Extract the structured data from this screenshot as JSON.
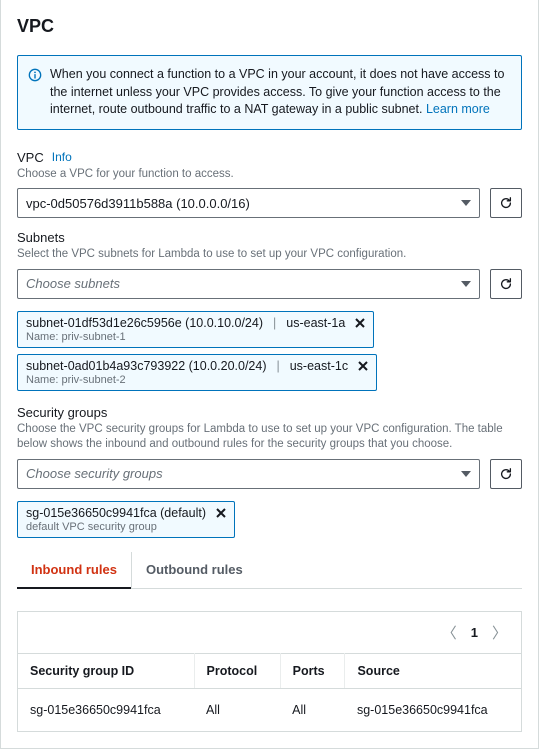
{
  "page": {
    "title": "VPC"
  },
  "info_box": {
    "text": "When you connect a function to a VPC in your account, it does not have access to the internet unless your VPC provides access. To give your function access to the internet, route outbound traffic to a NAT gateway in a public subnet.",
    "learn_more": "Learn more"
  },
  "vpc": {
    "label": "VPC",
    "info_link": "Info",
    "helper": "Choose a VPC for your function to access.",
    "value": "vpc-0d50576d3911b588a (10.0.0.0/16)"
  },
  "subnets": {
    "label": "Subnets",
    "helper": "Select the VPC subnets for Lambda to use to set up your VPC configuration.",
    "placeholder": "Choose subnets",
    "tokens": [
      {
        "id": "subnet-01df53d1e26c5956e (10.0.10.0/24)",
        "zone": "us-east-1a",
        "name": "Name: priv-subnet-1"
      },
      {
        "id": "subnet-0ad01b4a93c793922 (10.0.20.0/24)",
        "zone": "us-east-1c",
        "name": "Name: priv-subnet-2"
      }
    ]
  },
  "security_groups": {
    "label": "Security groups",
    "helper": "Choose the VPC security groups for Lambda to use to set up your VPC configuration. The table below shows the inbound and outbound rules for the security groups that you choose.",
    "placeholder": "Choose security groups",
    "tokens": [
      {
        "id": "sg-015e36650c9941fca (default)",
        "name": "default VPC security group"
      }
    ]
  },
  "tabs": {
    "inbound": "Inbound rules",
    "outbound": "Outbound rules"
  },
  "pager": {
    "page": "1"
  },
  "table": {
    "headers": [
      "Security group ID",
      "Protocol",
      "Ports",
      "Source"
    ],
    "rows": [
      [
        "sg-015e36650c9941fca",
        "All",
        "All",
        "sg-015e36650c9941fca"
      ]
    ]
  }
}
